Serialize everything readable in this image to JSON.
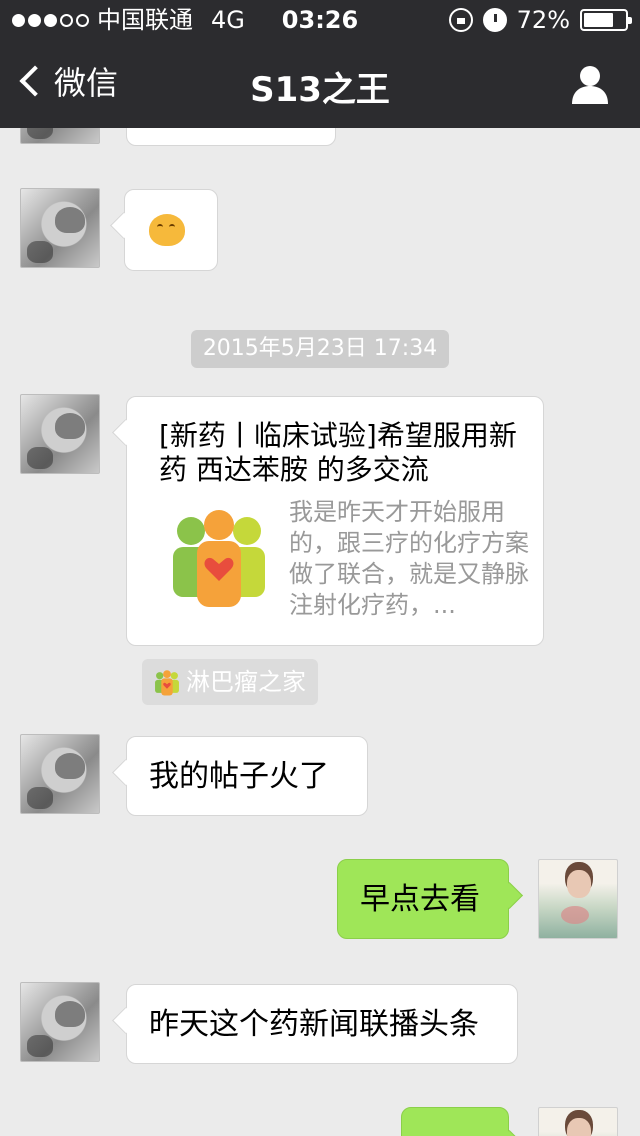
{
  "status_bar": {
    "carrier": "中国联通",
    "network": "4G",
    "time": "03:26",
    "battery": "72%",
    "battery_level": 0.72
  },
  "nav": {
    "back_label": "微信",
    "title": "S13之王"
  },
  "messages": {
    "timestamp": "2015年5月23日 17:34",
    "card": {
      "title": "[新药丨临床试验]希望服用新药 西达苯胺 的多交流",
      "description": "我是昨天才开始服用的，跟三疗的化疗方案做了联合，就是又静脉注射化疗药，...",
      "source": "淋巴瘤之家"
    },
    "msg_1": "我的帖子火了",
    "msg_2": "早点去看",
    "msg_3": "昨天这个药新闻联播头条"
  },
  "colors": {
    "nav_bg": "#2c2c2f",
    "chat_bg": "#ebebeb",
    "out_bubble": "#9fe658"
  }
}
